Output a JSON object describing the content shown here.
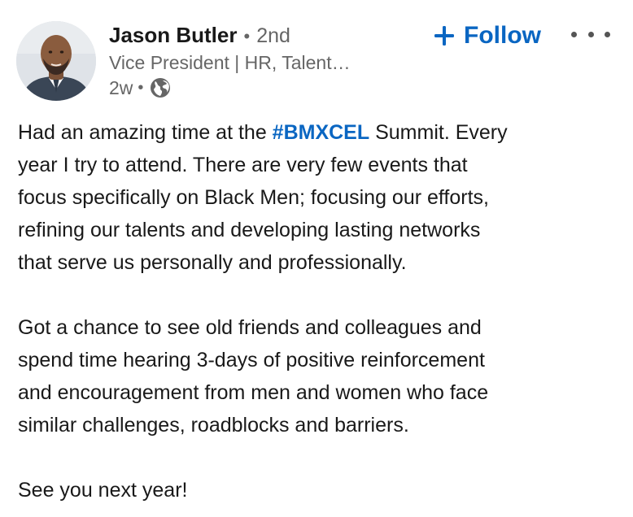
{
  "author": {
    "name": "Jason Butler",
    "connection_sep": "•",
    "connection_degree": "2nd",
    "headline": "Vice President | HR, Talent…",
    "time_ago": "2w",
    "meta_sep": "•",
    "visibility_icon": "globe-icon",
    "avatar_icon": "profile-photo"
  },
  "actions": {
    "follow_icon": "plus-icon",
    "follow_label": "Follow",
    "more_icon": "ellipsis-icon"
  },
  "post": {
    "p1_lines": [
      {
        "before": "Had an amazing time at the ",
        "hashtag": "#BMXCEL",
        "after": " Summit. Every"
      },
      {
        "text": "year I try to attend. There are very few events that"
      },
      {
        "text": "focus specifically on Black Men; focusing our efforts,"
      },
      {
        "text": "refining our talents and developing lasting networks"
      },
      {
        "text": "that serve us personally and professionally."
      }
    ],
    "p2_lines": [
      {
        "text": "Got a chance to see old friends and colleagues and"
      },
      {
        "text": "spend time hearing 3-days of positive reinforcement"
      },
      {
        "text": "and encouragement from men and women who face"
      },
      {
        "text": "similar challenges, roadblocks and barriers."
      }
    ],
    "p3_lines": [
      {
        "text": "See you next year!"
      }
    ]
  },
  "colors": {
    "link_blue": "#0a66c2",
    "text_primary": "#191919",
    "text_secondary": "#666666"
  }
}
